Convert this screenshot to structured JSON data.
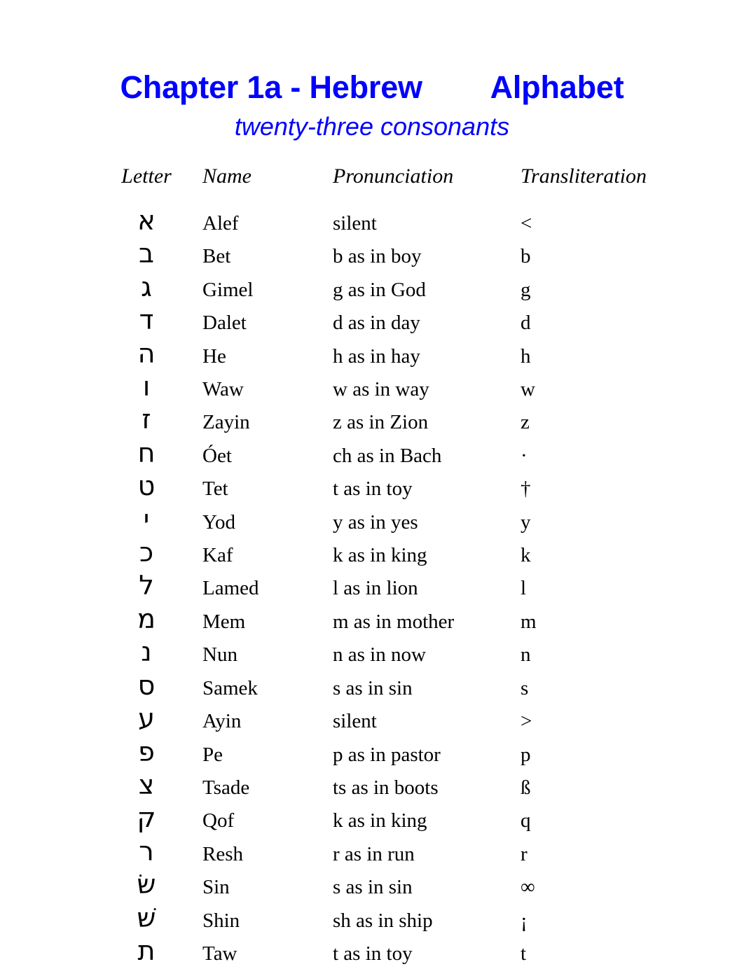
{
  "document": {
    "title": "Chapter 1a - Hebrew        Alphabet",
    "subtitle": "twenty-three consonants",
    "title_color": "#0000FF",
    "text_color": "#000000",
    "background_color": "#FFFFFF"
  },
  "table": {
    "headers": {
      "letter": "Letter",
      "name": "Name",
      "pronunciation": "Pronunciation",
      "transliteration": "Transliteration"
    },
    "rows": [
      {
        "letter": "א",
        "name": "Alef",
        "pronunciation": "silent",
        "transliteration": "<"
      },
      {
        "letter": "ב",
        "name": "Bet",
        "pronunciation": "b as in boy",
        "transliteration": "b"
      },
      {
        "letter": "ג",
        "name": "Gimel",
        "pronunciation": "g as in God",
        "transliteration": "g"
      },
      {
        "letter": "ד",
        "name": "Dalet",
        "pronunciation": "d as in day",
        "transliteration": "d"
      },
      {
        "letter": "ה",
        "name": "He",
        "pronunciation": "h as in hay",
        "transliteration": "h"
      },
      {
        "letter": "ו",
        "name": "Waw",
        "pronunciation": "w as in way",
        "transliteration": "w"
      },
      {
        "letter": "ז",
        "name": "Zayin",
        "pronunciation": "z as in Zion",
        "transliteration": "z"
      },
      {
        "letter": "ח",
        "name": "Óet",
        "pronunciation": "ch as in Bach",
        "transliteration": "·"
      },
      {
        "letter": "ט",
        "name": "Tet",
        "pronunciation": "t as in toy",
        "transliteration": "†"
      },
      {
        "letter": "י",
        "name": "Yod",
        "pronunciation": "y as in yes",
        "transliteration": "y"
      },
      {
        "letter": "כ",
        "name": "Kaf",
        "pronunciation": "k as in king",
        "transliteration": "k"
      },
      {
        "letter": "ל",
        "name": "Lamed",
        "pronunciation": "l as in lion",
        "transliteration": "l"
      },
      {
        "letter": "מ",
        "name": "Mem",
        "pronunciation": "m as in mother",
        "transliteration": "m"
      },
      {
        "letter": "נ",
        "name": "Nun",
        "pronunciation": "n as in now",
        "transliteration": "n"
      },
      {
        "letter": "ס",
        "name": "Samek",
        "pronunciation": "s as in sin",
        "transliteration": "s"
      },
      {
        "letter": "ע",
        "name": "Ayin",
        "pronunciation": "silent",
        "transliteration": ">"
      },
      {
        "letter": "פ",
        "name": "Pe",
        "pronunciation": "p as in pastor",
        "transliteration": "p"
      },
      {
        "letter": "צ",
        "name": "Tsade",
        "pronunciation": "ts as in boots",
        "transliteration": "ß"
      },
      {
        "letter": "ק",
        "name": "Qof",
        "pronunciation": "k as in king",
        "transliteration": "q"
      },
      {
        "letter": "ר",
        "name": "Resh",
        "pronunciation": "r as in run",
        "transliteration": "r"
      },
      {
        "letter": "שׂ",
        "name": "Sin",
        "pronunciation": "s as in sin",
        "transliteration": "∞"
      },
      {
        "letter": "שׁ",
        "name": "Shin",
        "pronunciation": "sh as in ship",
        "transliteration": "¡"
      },
      {
        "letter": "ת",
        "name": "Taw",
        "pronunciation": "t as in toy",
        "transliteration": "t"
      }
    ]
  }
}
